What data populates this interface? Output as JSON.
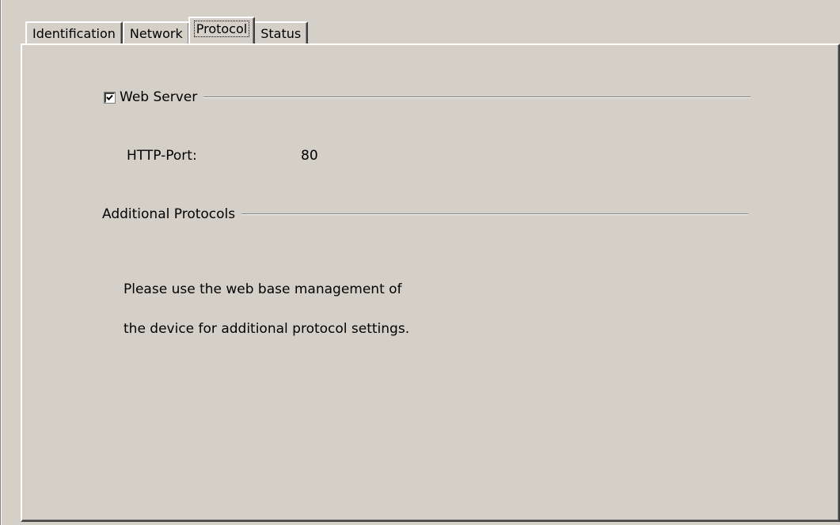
{
  "tabs": [
    {
      "label": "Identification",
      "selected": false
    },
    {
      "label": "Network",
      "selected": false
    },
    {
      "label": "Protocol",
      "selected": true
    },
    {
      "label": "Status",
      "selected": false
    }
  ],
  "web_server": {
    "label": "Web Server",
    "checked": true
  },
  "http_port": {
    "label": "HTTP-Port:",
    "value": "80"
  },
  "additional_protocols": {
    "title": "Additional Protocols",
    "note_line1": "Please use the web base management of",
    "note_line2": "the device for additional protocol settings."
  },
  "colors": {
    "face": "#d4d0c8",
    "highlight": "#ffffff",
    "shadow": "#808080",
    "dark_shadow": "#404040"
  }
}
